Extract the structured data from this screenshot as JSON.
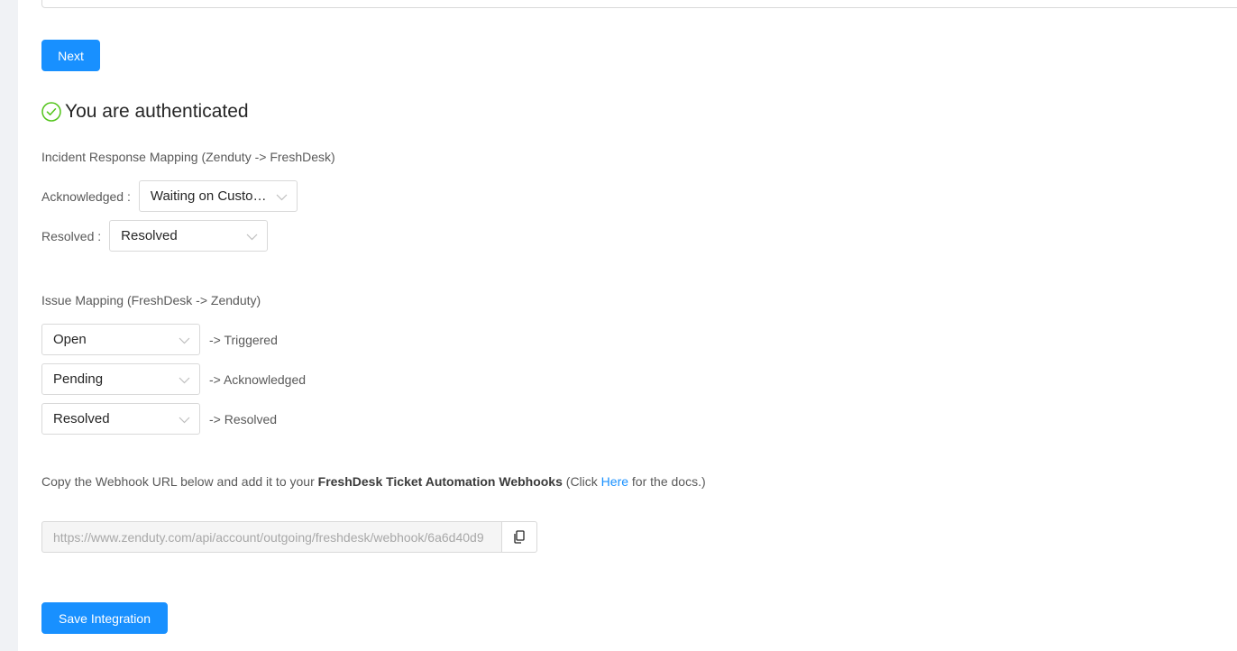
{
  "top_field": {
    "value": ""
  },
  "next_button": {
    "label": "Next"
  },
  "auth": {
    "title": "You are authenticated",
    "icon": "check-circle-icon",
    "color": "#52c41a"
  },
  "incident_mapping": {
    "title": "Incident Response Mapping (Zenduty -> FreshDesk)",
    "rows": [
      {
        "label": "Acknowledged :",
        "selected": "Waiting on Customer"
      },
      {
        "label": "Resolved :",
        "selected": "Resolved"
      }
    ]
  },
  "issue_mapping": {
    "title": "Issue Mapping (FreshDesk -> Zenduty)",
    "rows": [
      {
        "selected": "Open",
        "target": "-> Triggered"
      },
      {
        "selected": "Pending",
        "target": "-> Acknowledged"
      },
      {
        "selected": "Resolved",
        "target": "-> Resolved"
      }
    ]
  },
  "webhook": {
    "text_before": "Copy the Webhook URL below and add it to your ",
    "text_bold": "FreshDesk Ticket Automation Webhooks",
    "text_mid": " (Click ",
    "link_label": "Here",
    "text_after": " for the docs.)",
    "url": "https://www.zenduty.com/api/account/outgoing/freshdesk/webhook/6a6d40d9",
    "copy_icon": "copy-icon"
  },
  "save_button": {
    "label": "Save Integration"
  },
  "colors": {
    "primary": "#1890ff",
    "success": "#52c41a",
    "border": "#d9d9d9"
  }
}
